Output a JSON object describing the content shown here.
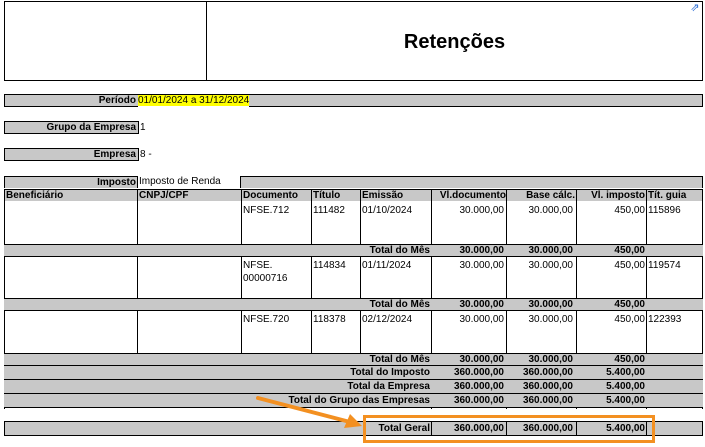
{
  "title": "Retenções",
  "filters": {
    "periodo_label": "Período",
    "periodo_value": "01/01/2024 a 31/12/2024",
    "grupo_label": "Grupo da Empresa",
    "grupo_value": "1",
    "empresa_label": "Empresa",
    "empresa_value": "8 -",
    "imposto_label": "Imposto",
    "imposto_value": "Imposto de Renda"
  },
  "columns": {
    "beneficiario": "Beneficiário",
    "cnpj": "CNPJ/CPF",
    "documento": "Documento",
    "titulo": "Título",
    "emissao": "Emissão",
    "vl_documento": "Vl.documento",
    "base_calc": "Base cálc.",
    "vl_imposto": "Vl. imposto",
    "tit_guia": "Tít. guia"
  },
  "rows": [
    {
      "documento": "NFSE.712",
      "titulo": "111482",
      "emissao": "01/10/2024",
      "vl_documento": "30.000,00",
      "base_calc": "30.000,00",
      "vl_imposto": "450,00",
      "tit_guia": "115896"
    },
    {
      "documento": "NFSE.",
      "documento2": "00000716",
      "titulo": "114834",
      "emissao": "01/11/2024",
      "vl_documento": "30.000,00",
      "base_calc": "30.000,00",
      "vl_imposto": "450,00",
      "tit_guia": "119574"
    },
    {
      "documento": "NFSE.720",
      "titulo": "118378",
      "emissao": "02/12/2024",
      "vl_documento": "30.000,00",
      "base_calc": "30.000,00",
      "vl_imposto": "450,00",
      "tit_guia": "122393"
    }
  ],
  "mes_total": {
    "label": "Total do Mês",
    "vl_documento": "30.000,00",
    "base_calc": "30.000,00",
    "vl_imposto": "450,00"
  },
  "totals": {
    "imposto": {
      "label": "Total do Imposto",
      "vl_documento": "360.000,00",
      "base_calc": "360.000,00",
      "vl_imposto": "5.400,00"
    },
    "empresa": {
      "label": "Total da Empresa",
      "vl_documento": "360.000,00",
      "base_calc": "360.000,00",
      "vl_imposto": "5.400,00"
    },
    "grupo": {
      "label": "Total do Grupo das Empresas",
      "vl_documento": "360.000,00",
      "base_calc": "360.000,00",
      "vl_imposto": "5.400,00"
    },
    "geral": {
      "label": "Total Geral",
      "vl_documento": "360.000,00",
      "base_calc": "360.000,00",
      "vl_imposto": "5.400,00"
    }
  },
  "colors": {
    "grey_band": "#c8c8c8",
    "highlight": "#ffff00",
    "annotation": "#f39021"
  }
}
